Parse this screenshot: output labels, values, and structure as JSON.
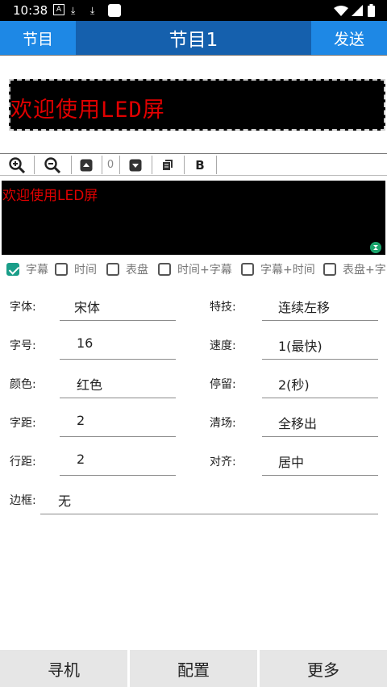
{
  "status_bar": {
    "time": "10:38",
    "icons": [
      "text-notification-icon",
      "download-icon",
      "download-icon",
      "app-notification-icon",
      "wifi-icon",
      "signal-icon",
      "battery-icon"
    ]
  },
  "app_bar": {
    "left_button": "节目",
    "title": "节目1",
    "right_button": "发送"
  },
  "preview": {
    "led_text": "欢迎使用LED屏",
    "led_color": "#e00000"
  },
  "toolbar": {
    "zoom_in_icon": "zoom-in-icon",
    "zoom_out_icon": "zoom-out-icon",
    "value": "0",
    "bold_label": "B"
  },
  "editor": {
    "text": "欢迎使用LED屏",
    "text_color": "#e00000"
  },
  "display_modes": [
    {
      "label": "字幕",
      "checked": true
    },
    {
      "label": "时间",
      "checked": false
    },
    {
      "label": "表盘",
      "checked": false
    },
    {
      "label": "时间+字幕",
      "checked": false
    },
    {
      "label": "字幕+时间",
      "checked": false
    },
    {
      "label": "表盘+字",
      "checked": false
    }
  ],
  "settings": {
    "font_label": "字体:",
    "font_value": "宋体",
    "effect_label": "特技:",
    "effect_value": "连续左移",
    "size_label": "字号:",
    "size_value": "16",
    "speed_label": "速度:",
    "speed_value": "1(最快)",
    "color_label": "颜色:",
    "color_value": "红色",
    "stay_label": "停留:",
    "stay_value": "2(秒)",
    "spacing_label": "字距:",
    "spacing_value": "2",
    "clear_label": "清场:",
    "clear_value": "全移出",
    "line_spacing_label": "行距:",
    "line_spacing_value": "2",
    "align_label": "对齐:",
    "align_value": "居中",
    "border_label": "边框:",
    "border_value": "无"
  },
  "bottom_bar": {
    "search_label": "寻机",
    "config_label": "配置",
    "more_label": "更多"
  },
  "colors": {
    "app_bar": "#1560ad",
    "app_bar_button": "#1e88e5",
    "checkbox_accent": "#1a9e89"
  }
}
